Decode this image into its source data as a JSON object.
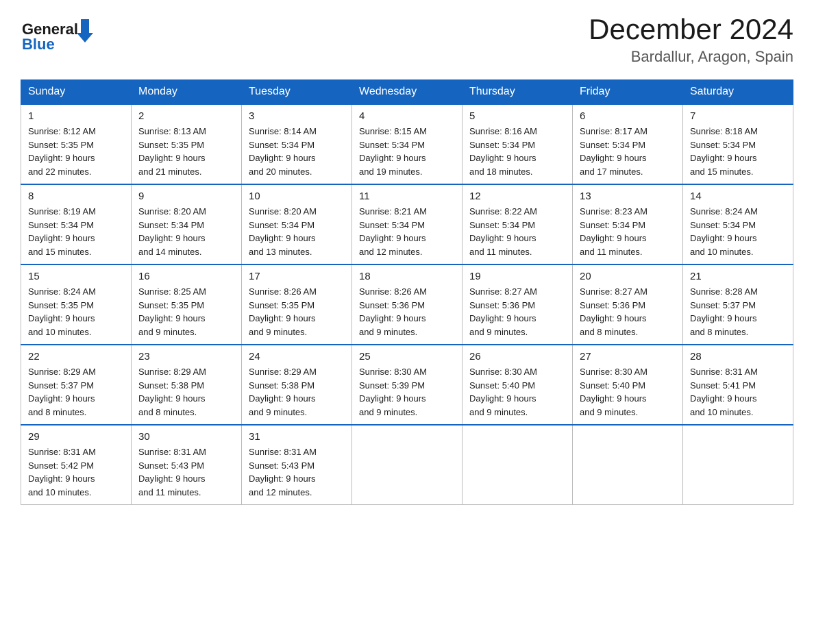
{
  "header": {
    "logo_general": "General",
    "logo_blue": "Blue",
    "month_title": "December 2024",
    "location": "Bardallur, Aragon, Spain"
  },
  "weekdays": [
    "Sunday",
    "Monday",
    "Tuesday",
    "Wednesday",
    "Thursday",
    "Friday",
    "Saturday"
  ],
  "weeks": [
    [
      {
        "day": "1",
        "sunrise": "8:12 AM",
        "sunset": "5:35 PM",
        "daylight": "9 hours and 22 minutes."
      },
      {
        "day": "2",
        "sunrise": "8:13 AM",
        "sunset": "5:35 PM",
        "daylight": "9 hours and 21 minutes."
      },
      {
        "day": "3",
        "sunrise": "8:14 AM",
        "sunset": "5:34 PM",
        "daylight": "9 hours and 20 minutes."
      },
      {
        "day": "4",
        "sunrise": "8:15 AM",
        "sunset": "5:34 PM",
        "daylight": "9 hours and 19 minutes."
      },
      {
        "day": "5",
        "sunrise": "8:16 AM",
        "sunset": "5:34 PM",
        "daylight": "9 hours and 18 minutes."
      },
      {
        "day": "6",
        "sunrise": "8:17 AM",
        "sunset": "5:34 PM",
        "daylight": "9 hours and 17 minutes."
      },
      {
        "day": "7",
        "sunrise": "8:18 AM",
        "sunset": "5:34 PM",
        "daylight": "9 hours and 15 minutes."
      }
    ],
    [
      {
        "day": "8",
        "sunrise": "8:19 AM",
        "sunset": "5:34 PM",
        "daylight": "9 hours and 15 minutes."
      },
      {
        "day": "9",
        "sunrise": "8:20 AM",
        "sunset": "5:34 PM",
        "daylight": "9 hours and 14 minutes."
      },
      {
        "day": "10",
        "sunrise": "8:20 AM",
        "sunset": "5:34 PM",
        "daylight": "9 hours and 13 minutes."
      },
      {
        "day": "11",
        "sunrise": "8:21 AM",
        "sunset": "5:34 PM",
        "daylight": "9 hours and 12 minutes."
      },
      {
        "day": "12",
        "sunrise": "8:22 AM",
        "sunset": "5:34 PM",
        "daylight": "9 hours and 11 minutes."
      },
      {
        "day": "13",
        "sunrise": "8:23 AM",
        "sunset": "5:34 PM",
        "daylight": "9 hours and 11 minutes."
      },
      {
        "day": "14",
        "sunrise": "8:24 AM",
        "sunset": "5:34 PM",
        "daylight": "9 hours and 10 minutes."
      }
    ],
    [
      {
        "day": "15",
        "sunrise": "8:24 AM",
        "sunset": "5:35 PM",
        "daylight": "9 hours and 10 minutes."
      },
      {
        "day": "16",
        "sunrise": "8:25 AM",
        "sunset": "5:35 PM",
        "daylight": "9 hours and 9 minutes."
      },
      {
        "day": "17",
        "sunrise": "8:26 AM",
        "sunset": "5:35 PM",
        "daylight": "9 hours and 9 minutes."
      },
      {
        "day": "18",
        "sunrise": "8:26 AM",
        "sunset": "5:36 PM",
        "daylight": "9 hours and 9 minutes."
      },
      {
        "day": "19",
        "sunrise": "8:27 AM",
        "sunset": "5:36 PM",
        "daylight": "9 hours and 9 minutes."
      },
      {
        "day": "20",
        "sunrise": "8:27 AM",
        "sunset": "5:36 PM",
        "daylight": "9 hours and 8 minutes."
      },
      {
        "day": "21",
        "sunrise": "8:28 AM",
        "sunset": "5:37 PM",
        "daylight": "9 hours and 8 minutes."
      }
    ],
    [
      {
        "day": "22",
        "sunrise": "8:29 AM",
        "sunset": "5:37 PM",
        "daylight": "9 hours and 8 minutes."
      },
      {
        "day": "23",
        "sunrise": "8:29 AM",
        "sunset": "5:38 PM",
        "daylight": "9 hours and 8 minutes."
      },
      {
        "day": "24",
        "sunrise": "8:29 AM",
        "sunset": "5:38 PM",
        "daylight": "9 hours and 9 minutes."
      },
      {
        "day": "25",
        "sunrise": "8:30 AM",
        "sunset": "5:39 PM",
        "daylight": "9 hours and 9 minutes."
      },
      {
        "day": "26",
        "sunrise": "8:30 AM",
        "sunset": "5:40 PM",
        "daylight": "9 hours and 9 minutes."
      },
      {
        "day": "27",
        "sunrise": "8:30 AM",
        "sunset": "5:40 PM",
        "daylight": "9 hours and 9 minutes."
      },
      {
        "day": "28",
        "sunrise": "8:31 AM",
        "sunset": "5:41 PM",
        "daylight": "9 hours and 10 minutes."
      }
    ],
    [
      {
        "day": "29",
        "sunrise": "8:31 AM",
        "sunset": "5:42 PM",
        "daylight": "9 hours and 10 minutes."
      },
      {
        "day": "30",
        "sunrise": "8:31 AM",
        "sunset": "5:43 PM",
        "daylight": "9 hours and 11 minutes."
      },
      {
        "day": "31",
        "sunrise": "8:31 AM",
        "sunset": "5:43 PM",
        "daylight": "9 hours and 12 minutes."
      },
      null,
      null,
      null,
      null
    ]
  ],
  "labels": {
    "sunrise": "Sunrise:",
    "sunset": "Sunset:",
    "daylight": "Daylight:"
  }
}
